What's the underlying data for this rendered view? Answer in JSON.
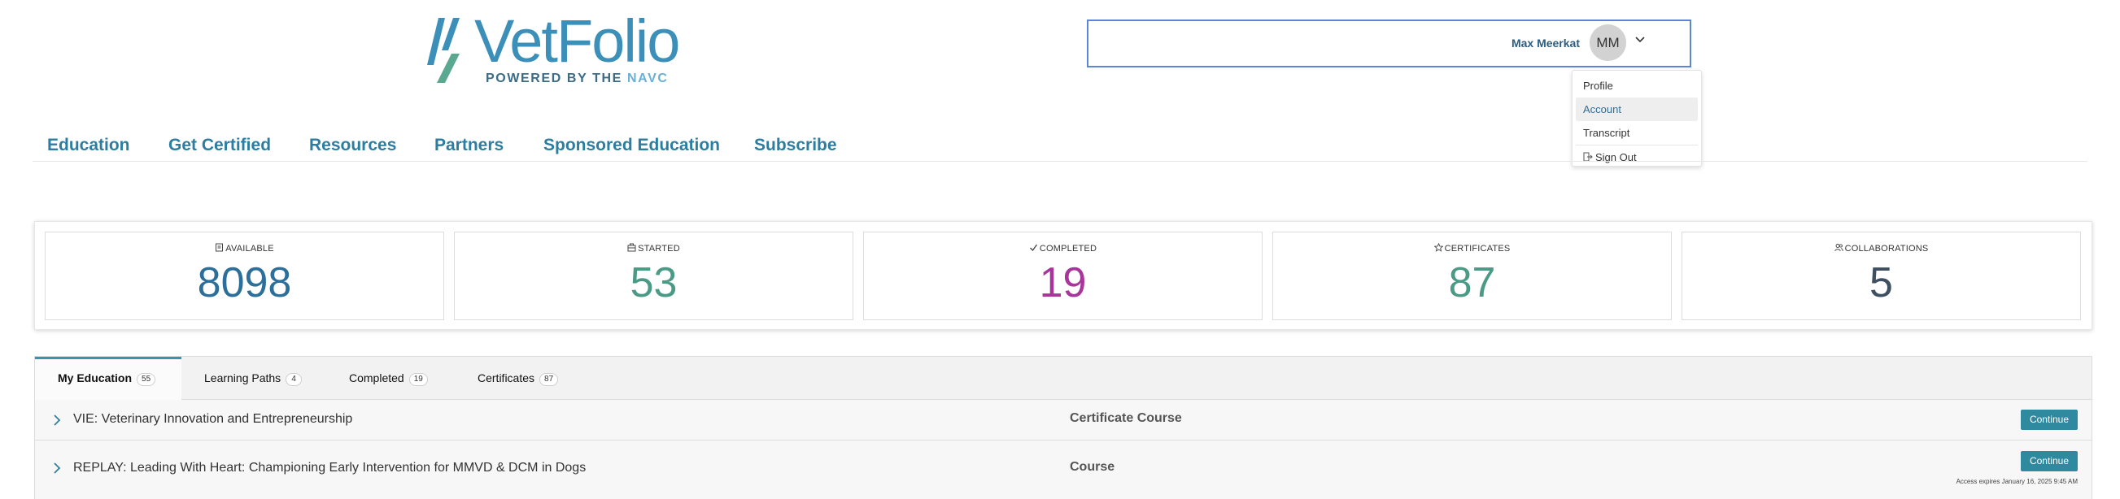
{
  "brand": {
    "name_part1": "Vet",
    "name_part2": "Folio",
    "tagline_prefix": "POWERED BY THE ",
    "tagline_org": "NAVC",
    "primary_color": "#3b8fb9",
    "accent_green": "#4a9a86"
  },
  "user": {
    "name": "Max Meerkat",
    "initials": "MM"
  },
  "user_menu": {
    "items": [
      {
        "label": "Profile"
      },
      {
        "label": "Account"
      },
      {
        "label": "Transcript"
      },
      {
        "label": "Sign Out",
        "icon": "sign-out-icon"
      }
    ],
    "highlighted": "Account"
  },
  "nav": {
    "items": [
      {
        "label": "Education"
      },
      {
        "label": "Get Certified"
      },
      {
        "label": "Resources"
      },
      {
        "label": "Partners"
      },
      {
        "label": "Sponsored Education"
      },
      {
        "label": "Subscribe"
      }
    ]
  },
  "stats": [
    {
      "label": "AVAILABLE",
      "value": "8098",
      "icon": "book-icon",
      "color": "#2b6f9a"
    },
    {
      "label": "STARTED",
      "value": "53",
      "icon": "bag-icon",
      "color": "#4a9a86"
    },
    {
      "label": "COMPLETED",
      "value": "19",
      "icon": "check-icon",
      "color": "#a8349c"
    },
    {
      "label": "CERTIFICATES",
      "value": "87",
      "icon": "star-icon",
      "color": "#4a9a86"
    },
    {
      "label": "COLLABORATIONS",
      "value": "5",
      "icon": "users-icon",
      "color": "#3d4f61"
    }
  ],
  "tabs": [
    {
      "label": "My Education",
      "count": "55"
    },
    {
      "label": "Learning Paths",
      "count": "4"
    },
    {
      "label": "Completed",
      "count": "19"
    },
    {
      "label": "Certificates",
      "count": "87"
    }
  ],
  "active_tab": "My Education",
  "courses": [
    {
      "title": "VIE: Veterinary Innovation and Entrepreneurship",
      "type": "Certificate Course",
      "action": "Continue",
      "note": ""
    },
    {
      "title": "REPLAY: Leading With Heart: Championing Early Intervention for MMVD & DCM in Dogs",
      "type": "Course",
      "action": "Continue",
      "note": "Access expires January 16, 2025 9:45 AM"
    }
  ]
}
